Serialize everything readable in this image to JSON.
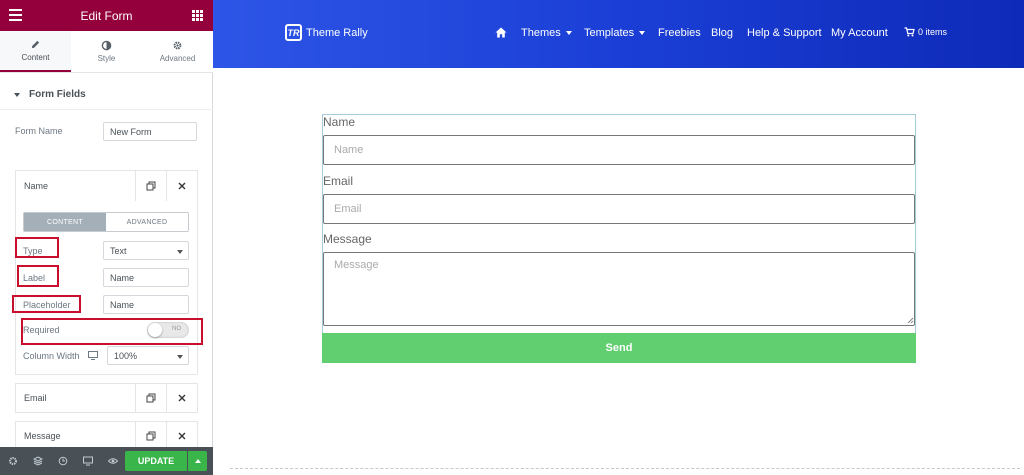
{
  "panel": {
    "title": "Edit Form",
    "tabs": [
      {
        "label": "Content",
        "icon": "pencil-icon"
      },
      {
        "label": "Style",
        "icon": "contrast-icon"
      },
      {
        "label": "Advanced",
        "icon": "gear-icon"
      }
    ],
    "section_title": "Form Fields",
    "form_name_label": "Form Name",
    "form_name_value": "New Form",
    "repeater_items": [
      "Name",
      "Email",
      "Message"
    ],
    "field_tabs": [
      "CONTENT",
      "ADVANCED"
    ],
    "type_label": "Type",
    "type_value": "Text",
    "label_label": "Label",
    "label_value": "Name",
    "placeholder_label": "Placeholder",
    "placeholder_value": "Name",
    "required_label": "Required",
    "required_toggle_text": "NO",
    "column_width_label": "Column Width",
    "column_width_value": "100%",
    "update_label": "UPDATE",
    "accent_color": "#93003c",
    "update_color": "#39b54a"
  },
  "site": {
    "logo_mark": "TR",
    "logo_name": "Theme Rally",
    "menu": [
      "Themes",
      "Templates",
      "Freebies",
      "Blog",
      "Help & Support",
      "My Account"
    ],
    "cart": "0 items",
    "nav_color": "#1b3fd6"
  },
  "form": {
    "fields": [
      {
        "label": "Name",
        "placeholder": "Name"
      },
      {
        "label": "Email",
        "placeholder": "Email"
      },
      {
        "label": "Message",
        "placeholder": "Message"
      }
    ],
    "send_label": "Send",
    "send_color": "#61ce70"
  }
}
